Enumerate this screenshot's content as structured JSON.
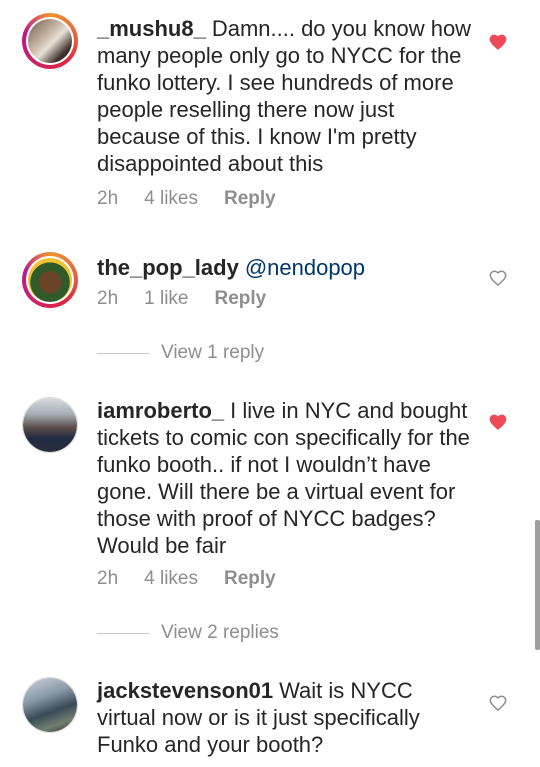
{
  "comments": [
    {
      "username": "_mushu8_",
      "text": "Damn.... do you know how many people only go to NYCC for the funko lottery. I see hundreds of more people reselling there now just because of this. I know I'm pretty disappointed about this",
      "time": "2h",
      "likes": "4 likes",
      "reply_label": "Reply",
      "liked": true
    },
    {
      "username": "the_pop_lady",
      "text": "@nendopop",
      "time": "2h",
      "likes": "1 like",
      "reply_label": "Reply",
      "liked": false,
      "view_replies": "View 1 reply"
    },
    {
      "username": "iamroberto_",
      "text": "I live in NYC and bought tickets to comic con specifically for the funko booth.. if not I wouldn’t have gone. Will there be a virtual event for those with proof of NYCC badges? Would be fair",
      "time": "2h",
      "likes": "4 likes",
      "reply_label": "Reply",
      "liked": true,
      "view_replies": "View 2 replies"
    },
    {
      "username": "jackstevenson01",
      "text": "Wait is NYCC virtual now or is it just specifically Funko and your booth?",
      "liked": false
    }
  ],
  "icons": {
    "heart_filled": "heart-filled-icon",
    "heart_outline": "heart-outline-icon"
  },
  "colors": {
    "like_red": "#ed4956",
    "meta_gray": "#8e8e8e",
    "mention_blue": "#00376b"
  }
}
